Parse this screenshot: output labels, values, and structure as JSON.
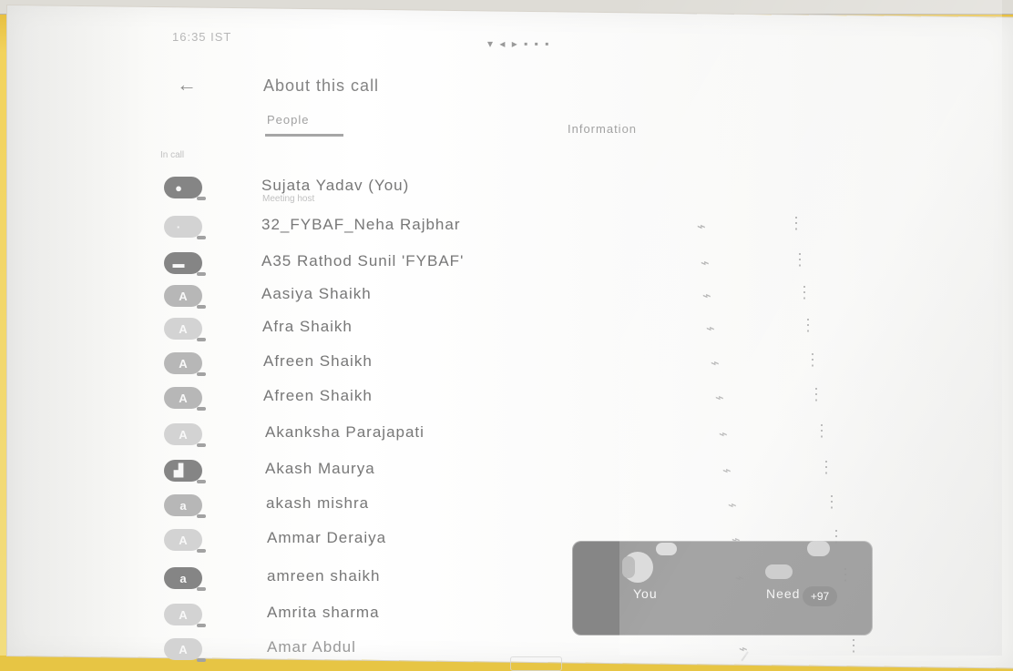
{
  "status": {
    "time": "16:35 IST",
    "right": "▾ ◂ ▸ ▪ ▪ ▪"
  },
  "header": {
    "back_icon": "back-arrow-icon",
    "title": "About this call"
  },
  "tabs": [
    {
      "label": "People"
    },
    {
      "label": "Information"
    }
  ],
  "section": {
    "heading": "In call"
  },
  "people": [
    {
      "name": "Sujata Yadav (You)",
      "role": "Meeting host",
      "avatar": "",
      "avatar_tone": "dark"
    },
    {
      "name": "32_FYBAF_Neha Rajbhar",
      "role": "",
      "avatar": "",
      "avatar_tone": "light"
    },
    {
      "name": "A35 Rathod Sunil 'FYBAF'",
      "role": "",
      "avatar": "",
      "avatar_tone": "dark"
    },
    {
      "name": "Aasiya Shaikh",
      "role": "",
      "avatar": "A",
      "avatar_tone": "normal"
    },
    {
      "name": "Afra Shaikh",
      "role": "",
      "avatar": "A",
      "avatar_tone": "light"
    },
    {
      "name": "Afreen Shaikh",
      "role": "",
      "avatar": "A",
      "avatar_tone": "normal"
    },
    {
      "name": "Afreen Shaikh",
      "role": "",
      "avatar": "A",
      "avatar_tone": "normal"
    },
    {
      "name": "Akanksha Parajapati",
      "role": "",
      "avatar": "A",
      "avatar_tone": "light"
    },
    {
      "name": "Akash Maurya",
      "role": "",
      "avatar": "",
      "avatar_tone": "dark"
    },
    {
      "name": "akash mishra",
      "role": "",
      "avatar": "a",
      "avatar_tone": "normal"
    },
    {
      "name": "Ammar Deraiya",
      "role": "",
      "avatar": "A",
      "avatar_tone": "light"
    },
    {
      "name": "amreen shaikh",
      "role": "",
      "avatar": "a",
      "avatar_tone": "normal"
    },
    {
      "name": "Amrita sharma",
      "role": "",
      "avatar": "A",
      "avatar_tone": "light"
    },
    {
      "name": "Amar Abdul",
      "role": "",
      "avatar": "A",
      "avatar_tone": "light"
    }
  ],
  "call_card": {
    "you_label": "You",
    "needs_label": "Need",
    "count": "+97"
  },
  "icons": {
    "mic": "mic-off-icon",
    "more": "more-vertical-icon"
  }
}
